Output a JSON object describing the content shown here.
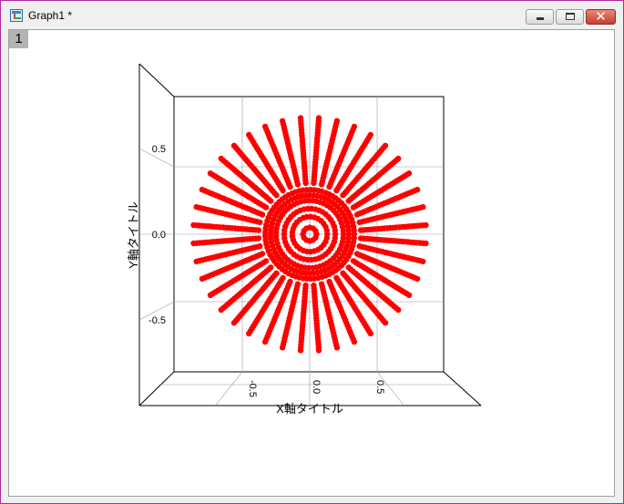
{
  "window": {
    "title": "Graph1 *",
    "close_glyph": "✕"
  },
  "layer_tab": "1",
  "colors": {
    "frame": "#b02aa0",
    "points": "#ff0000",
    "axis": "#000000",
    "grid": "#9a9a9a"
  },
  "chart_data": {
    "type": "scatter",
    "style": "3D scatter viewed from front; points arranged as radial spokes and concentric rings",
    "xlabel": "X軸タイトル",
    "ylabel": "Y軸タイトル",
    "x_ticks": [
      "-0.5",
      "0.0",
      "0.5"
    ],
    "y_ticks": [
      "0.5",
      "0.0",
      "-0.5"
    ],
    "xlim": [
      -1,
      1
    ],
    "ylim": [
      -1,
      1
    ],
    "grid": true,
    "spokes": 40,
    "spoke_radius_range": [
      0.38,
      0.88
    ],
    "rings": [
      0.05,
      0.13,
      0.19,
      0.25,
      0.29,
      0.33
    ]
  }
}
